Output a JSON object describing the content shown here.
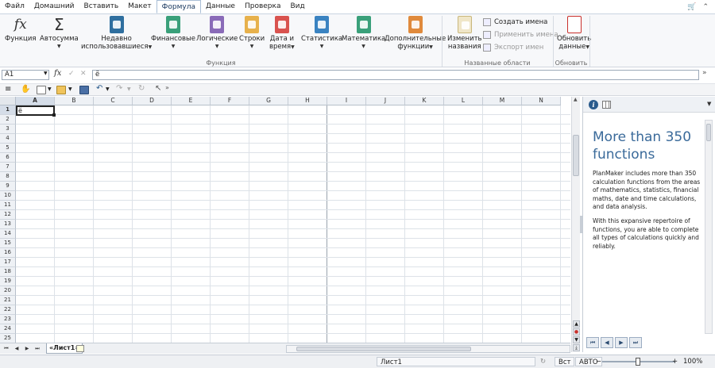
{
  "menu": {
    "items": [
      "Файл",
      "Домашний",
      "Вставить",
      "Макет",
      "Формула",
      "Данные",
      "Проверка",
      "Вид"
    ],
    "active_index": 4
  },
  "ribbon": {
    "groups": {
      "function": "Функция",
      "named_ranges": "Названные области",
      "update": "Обновить"
    },
    "buttons": {
      "function": "Функция",
      "autosum": "Автосумма",
      "recent_1": "Недавно",
      "recent_2": "использовавшиеся",
      "financial": "Финансовые",
      "logical": "Логические",
      "text": "Строки",
      "datetime_1": "Дата и",
      "datetime_2": "время",
      "statistics": "Статистика",
      "math": "Математика",
      "extra_1": "Дополнительные",
      "extra_2": "функции",
      "change_names_1": "Изменить",
      "change_names_2": "названия",
      "create_names": "Создать имена",
      "apply_names": "Применить имена",
      "export_names": "Экспорт имен",
      "update_1": "Обновить",
      "update_2": "данные"
    },
    "colors": {
      "recent": "#2f6f9f",
      "financial": "#3aa07a",
      "logical": "#8a6bb8",
      "text": "#e7b14c",
      "datetime": "#d9534f",
      "statistics": "#3a83c1",
      "math": "#3aa07a",
      "extra": "#e08a3c",
      "update": "#c9302c"
    }
  },
  "formula_bar": {
    "cell_ref": "A1",
    "fx": "fx",
    "value": "ё"
  },
  "grid": {
    "columns": [
      "A",
      "B",
      "C",
      "D",
      "E",
      "F",
      "G",
      "H",
      "I",
      "J",
      "K",
      "L",
      "M",
      "N"
    ],
    "rows": [
      "1",
      "2",
      "3",
      "4",
      "5",
      "6",
      "7",
      "8",
      "9",
      "10",
      "11",
      "12",
      "13",
      "14",
      "15",
      "16",
      "17",
      "18",
      "19",
      "20",
      "21",
      "22",
      "23",
      "24",
      "25"
    ],
    "active_cell_value": "ё"
  },
  "sheet": {
    "tab_label": "«Лист1»"
  },
  "side_panel": {
    "title": "More than 350 functions",
    "para1": "PlanMaker includes more than 350 calculation functions from the areas of mathematics, statistics, financial maths, date and time calculations, and data analysis.",
    "para2": "With this expansive repertoire of functions, you are able to complete all types of calculations quickly and reliably."
  },
  "status": {
    "sheet_name": "Лист1",
    "insert_mode": "Вст",
    "calc_mode": "АВТО",
    "zoom": "100%"
  }
}
